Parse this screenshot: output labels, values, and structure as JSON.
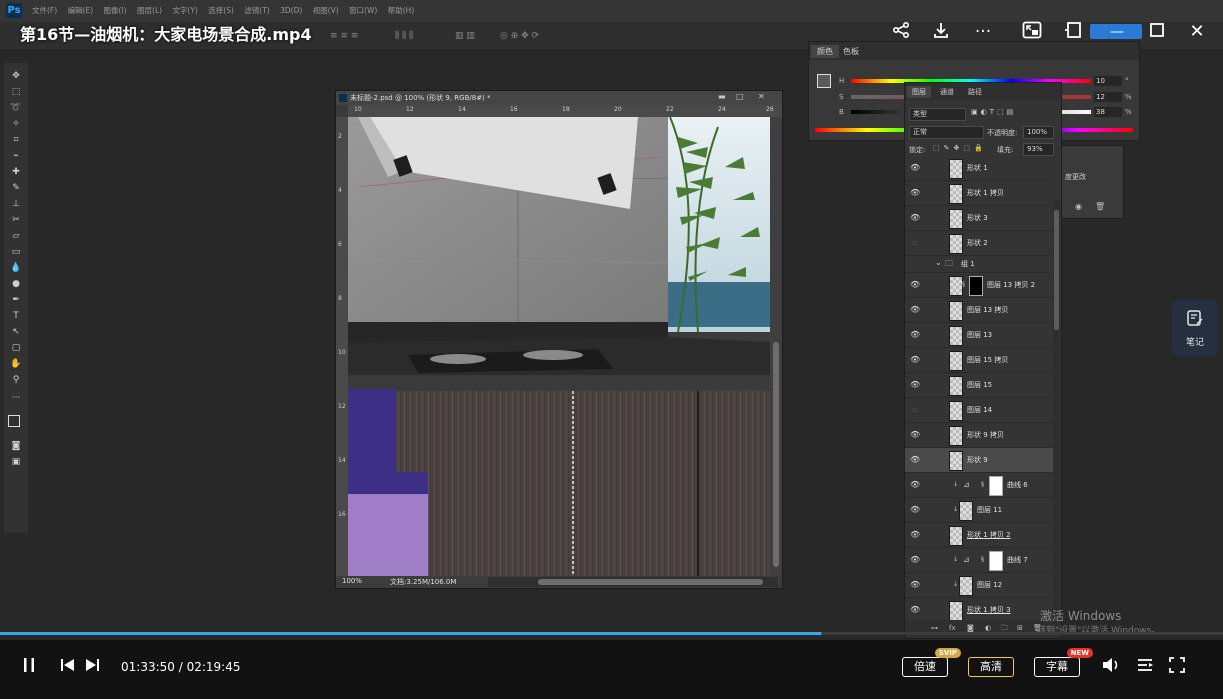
{
  "video": {
    "title": "第16节—油烟机：大家电场景合成.mp4",
    "current_time": "01:33:50",
    "duration": "02:19:45",
    "time_display": "01:33:50 / 02:19:45",
    "progress_fraction": 0.671
  },
  "player_controls": {
    "speed_label": "倍速",
    "speed_badge": "SVIP",
    "quality_label": "高清",
    "subtitle_label": "字幕",
    "subtitle_badge": "NEW",
    "note_label": "笔记"
  },
  "colors": {
    "accent_progress": "#3ba5f0",
    "svip_badge": "#d9a441",
    "new_badge": "#e5332a",
    "quality_border": "#f0c860"
  },
  "photoshop": {
    "menus": [
      "文件(F)",
      "编辑(E)",
      "图像(I)",
      "图层(L)",
      "文字(Y)",
      "选择(S)",
      "滤镜(T)",
      "3D(D)",
      "视图(V)",
      "窗口(W)",
      "帮助(H)"
    ],
    "document": {
      "title": "未标题-2.psd @ 100% (形状 9, RGB/8#) *",
      "zoom": "100%",
      "doc_info": "文档:3.25M/106.0M",
      "ruler_top": [
        "10",
        "12",
        "14",
        "16",
        "18",
        "20",
        "22",
        "24",
        "26"
      ],
      "ruler_left": [
        "2",
        "4",
        "6",
        "8",
        "10",
        "12",
        "14",
        "16"
      ]
    },
    "color_panel": {
      "tabs": [
        "颜色",
        "色板"
      ],
      "rows": [
        {
          "label": "H",
          "value": "10",
          "unit": "°"
        },
        {
          "label": "S",
          "value": "12",
          "unit": "%"
        },
        {
          "label": "B",
          "value": "38",
          "unit": "%"
        }
      ]
    },
    "layers_panel": {
      "tabs": [
        "图层",
        "通道",
        "路径"
      ],
      "filter_kind": "类型",
      "blend_mode": "正常",
      "opacity_label": "不透明度:",
      "opacity_value": "100%",
      "lock_label": "锁定:",
      "fill_label": "填充:",
      "fill_value": "93%",
      "layers": [
        {
          "name": "形状 1",
          "visible": true
        },
        {
          "name": "形状 1 拷贝",
          "visible": true
        },
        {
          "name": "形状 3",
          "visible": true
        },
        {
          "name": "形状 2",
          "visible": false
        },
        {
          "name": "组 1",
          "visible": true,
          "group": true
        },
        {
          "name": "图层 13 拷贝 2",
          "visible": true
        },
        {
          "name": "图层 13 拷贝",
          "visible": true
        },
        {
          "name": "图层 13",
          "visible": true
        },
        {
          "name": "图层 15 拷贝",
          "visible": true
        },
        {
          "name": "图层 15",
          "visible": true
        },
        {
          "name": "图层 14",
          "visible": false
        },
        {
          "name": "形状 9 拷贝",
          "visible": true
        },
        {
          "name": "形状 9",
          "visible": true,
          "selected": true
        },
        {
          "name": "曲线 6",
          "visible": true
        },
        {
          "name": "图层 11",
          "visible": true
        },
        {
          "name": "形状 1 拷贝 2",
          "visible": true
        },
        {
          "name": "曲线 7",
          "visible": true
        },
        {
          "name": "图层 12",
          "visible": true
        },
        {
          "name": "形状 1 拷贝 3",
          "visible": true
        }
      ],
      "footer_fx": "fx"
    },
    "history_snippet": "度更改"
  },
  "watermark": {
    "line1": "激活 Windows",
    "line2": "转到\"设置\"以激活 Windows。"
  },
  "icons": [
    "share-icon",
    "download-icon",
    "more-icon",
    "picture-in-picture-icon",
    "window-icon",
    "close-icon",
    "pause-icon",
    "prev-icon",
    "next-icon",
    "volume-icon",
    "playlist-icon",
    "fullscreen-icon",
    "note-icon"
  ]
}
